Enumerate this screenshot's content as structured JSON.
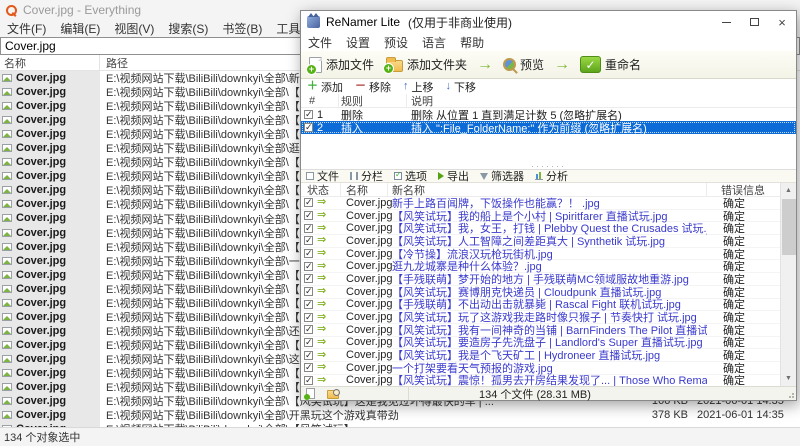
{
  "colors": {
    "selection": "#0c6bd7",
    "new_name_text": "#3a3acd",
    "accent_green": "#7cb82f",
    "everything_logo_orange": "#e25a1b"
  },
  "everything": {
    "window_title": "Cover.jpg - Everything",
    "menu": [
      "文件(F)",
      "编辑(E)",
      "视图(V)",
      "搜索(S)",
      "书签(B)",
      "工具(T)",
      "帮助(H)"
    ],
    "search_value": "Cover.jpg",
    "columns": {
      "name": "名称",
      "path": "路径"
    },
    "status": "134 个对象选中",
    "rows": [
      {
        "name": "Cover.jpg",
        "path": "E:\\视频网站下载\\BiliBili\\downkyi\\全部\\新手上路百闻牌，下饭操作也能赢？！",
        "size": "",
        "date": ""
      },
      {
        "name": "Cover.jpg",
        "path": "E:\\视频网站下载\\BiliBili\\downkyi\\全部\\【风笑试玩】我的船上是个小村 | Spiritfarer 直播试玩",
        "size": "",
        "date": ""
      },
      {
        "name": "Cover.jpg",
        "path": "E:\\视频网站下载\\BiliBili\\downkyi\\全部\\【风笑试玩】我，女王，打钱 | Plebby Quest the Crusades 试玩",
        "size": "",
        "date": ""
      },
      {
        "name": "Cover.jpg",
        "path": "E:\\视频网站下载\\BiliBili\\downkyi\\全部\\【风笑试玩】人工智障之间差距真大 | Synthetik 试玩",
        "size": "",
        "date": ""
      },
      {
        "name": "Cover.jpg",
        "path": "E:\\视频网站下载\\BiliBili\\downkyi\\全部\\【冷节操】流浪汉玩枪玩街机",
        "size": "",
        "date": ""
      },
      {
        "name": "Cover.jpg",
        "path": "E:\\视频网站下载\\BiliBili\\downkyi\\全部\\逛九龙城寨是种什么体验？",
        "size": "",
        "date": ""
      },
      {
        "name": "Cover.jpg",
        "path": "E:\\视频网站下载\\BiliBili\\downkyi\\全部\\【手残联萌】梦开始的地方 | 手残联萌MC领域服故地重游",
        "size": "",
        "date": ""
      },
      {
        "name": "Cover.jpg",
        "path": "E:\\视频网站下载\\BiliBili\\downkyi\\全部\\【风笑试玩】赛博朋克快递员 | Cloudpunk 直播试玩",
        "size": "",
        "date": ""
      },
      {
        "name": "Cover.jpg",
        "path": "E:\\视频网站下载\\BiliBili\\downkyi\\全部\\【手残联萌】不出动出击就暴毙 | Rascal Fight 联机试玩",
        "size": "",
        "date": ""
      },
      {
        "name": "Cover.jpg",
        "path": "E:\\视频网站下载\\BiliBili\\downkyi\\全部\\【风笑试玩】玩了这游戏我走路时像只猴子 | 节奏快打 试玩",
        "size": "",
        "date": ""
      },
      {
        "name": "Cover.jpg",
        "path": "E:\\视频网站下载\\BiliBili\\downkyi\\全部\\【风笑试玩】我有一间神奇的当铺 | BarnFinders The Pilot 直播试玩",
        "size": "",
        "date": ""
      },
      {
        "name": "Cover.jpg",
        "path": "E:\\视频网站下载\\BiliBili\\downkyi\\全部\\【风笑试玩】要造房子先洗盘子 | Landlord's Super 直播试玩",
        "size": "",
        "date": ""
      },
      {
        "name": "Cover.jpg",
        "path": "E:\\视频网站下载\\BiliBili\\downkyi\\全部\\【风笑试玩】我是个飞天矿工 | Hydroneer 直播试玩",
        "size": "",
        "date": ""
      },
      {
        "name": "Cover.jpg",
        "path": "E:\\视频网站下载\\BiliBili\\downkyi\\全部\\一个打架要看天气预报的游戏",
        "size": "",
        "date": ""
      },
      {
        "name": "Cover.jpg",
        "path": "E:\\视频网站下载\\BiliBili\\downkyi\\全部\\【风笑试玩】震惊！孤男去开房结果发现了... | Those Who Remain 试玩",
        "size": "",
        "date": ""
      },
      {
        "name": "Cover.jpg",
        "path": "E:\\视频网站下载\\BiliBili\\downkyi\\全部\\【风笑试玩】硬核剑",
        "size": "",
        "date": ""
      },
      {
        "name": "Cover.jpg",
        "path": "E:\\视频网站下载\\BiliBili\\downkyi\\全部\\【风笑试玩】神经兮",
        "size": "",
        "date": ""
      },
      {
        "name": "Cover.jpg",
        "path": "E:\\视频网站下载\\BiliBili\\downkyi\\全部\\【风笑试玩】我是个",
        "size": "",
        "date": ""
      },
      {
        "name": "Cover.jpg",
        "path": "E:\\视频网站下载\\BiliBili\\downkyi\\全部\\还是自虐游戏容易有",
        "size": "",
        "date": ""
      },
      {
        "name": "Cover.jpg",
        "path": "E:\\视频网站下载\\BiliBili\\downkyi\\全部\\【风笑试玩】山顶！",
        "size": "",
        "date": ""
      },
      {
        "name": "Cover.jpg",
        "path": "E:\\视频网站下载\\BiliBili\\downkyi\\全部\\这游戏针对我！！",
        "size": "",
        "date": ""
      },
      {
        "name": "Cover.jpg",
        "path": "E:\\视频网站下载\\BiliBili\\downkyi\\全部\\【风笑试玩】史上最",
        "size": "",
        "date": ""
      },
      {
        "name": "Cover.jpg",
        "path": "E:\\视频网站下载\\BiliBili\\downkyi\\全部\\【风笑试玩】天选之",
        "size": "",
        "date": ""
      },
      {
        "name": "Cover.jpg",
        "path": "E:\\视频网站下载\\BiliBili\\downkyi\\全部\\【风笑试玩】这是我见过坏得最快的车 | ...",
        "size": "166 KB",
        "date": "2021-06-01 14:35"
      },
      {
        "name": "Cover.jpg",
        "path": "E:\\视频网站下载\\BiliBili\\downkyi\\全部\\开黑玩这个游戏真带劲",
        "size": "378 KB",
        "date": "2021-06-01 14:35"
      },
      {
        "name": "Cover.jpg",
        "path": "E:\\视频网站下载\\BiliBili\\downkyi\\全部\\【风笑试玩】",
        "size": "",
        "date": ""
      }
    ]
  },
  "renamer": {
    "window_title": "ReNamer Lite",
    "license_note": "(仅用于非商业使用)",
    "menu": [
      "文件",
      "设置",
      "预设",
      "语言",
      "帮助"
    ],
    "toolbar": {
      "add_files": "添加文件",
      "add_folders": "添加文件夹",
      "preview": "预览",
      "rename": "重命名"
    },
    "rules_toolbar": {
      "add": "添加",
      "remove": "移除",
      "move_up": "上移",
      "move_down": "下移"
    },
    "rules_columns": {
      "num": "#",
      "rule": "规则",
      "description": "说明"
    },
    "rules": [
      {
        "num": "1",
        "rule": "删除",
        "description": "删除 从位置 1 直到满足计数 5 (忽略扩展名)",
        "checked": true,
        "selected": false
      },
      {
        "num": "2",
        "rule": "插入",
        "description": "插入 \":File_FolderName:\" 作为前缀 (忽略扩展名)",
        "checked": true,
        "selected": true
      }
    ],
    "files_toolbar": [
      "文件",
      "分栏",
      "选项",
      "导出",
      "筛选器",
      "分析"
    ],
    "files_columns": {
      "status": "状态",
      "name": "名称",
      "new_name": "新名称",
      "error": "错误信息"
    },
    "files": [
      {
        "name": "Cover.jpg",
        "new_name": "新手上路百闻牌，下饭操作也能赢？！ .jpg",
        "error": "确定"
      },
      {
        "name": "Cover.jpg",
        "new_name": "【风笑试玩】我的船上是个小村 | Spiritfarer 直播试玩.jpg",
        "error": "确定"
      },
      {
        "name": "Cover.jpg",
        "new_name": "【风笑试玩】我，女王，打钱 | Plebby Quest the Crusades 试玩.jpg",
        "error": "确定"
      },
      {
        "name": "Cover.jpg",
        "new_name": "【风笑试玩】人工智障之间差距真大 | Synthetik 试玩.jpg",
        "error": "确定"
      },
      {
        "name": "Cover.jpg",
        "new_name": "【冷节操】流浪汉玩枪玩街机.jpg",
        "error": "确定"
      },
      {
        "name": "Cover.jpg",
        "new_name": "逛九龙城寨是种什么体验？.jpg",
        "error": "确定"
      },
      {
        "name": "Cover.jpg",
        "new_name": "【手残联萌】梦开始的地方 | 手残联萌MC领域服故地重游.jpg",
        "error": "确定"
      },
      {
        "name": "Cover.jpg",
        "new_name": "【风笑试玩】赛博朋克快递员 | Cloudpunk 直播试玩.jpg",
        "error": "确定"
      },
      {
        "name": "Cover.jpg",
        "new_name": "【手残联萌】不出动出击就暴毙 | Rascal Fight 联机试玩.jpg",
        "error": "确定"
      },
      {
        "name": "Cover.jpg",
        "new_name": "【风笑试玩】玩了这游戏我走路时像只猴子 | 节奏快打 试玩.jpg",
        "error": "确定"
      },
      {
        "name": "Cover.jpg",
        "new_name": "【风笑试玩】我有一间神奇的当铺 | BarnFinders The Pilot 直播试玩.jpg",
        "error": "确定"
      },
      {
        "name": "Cover.jpg",
        "new_name": "【风笑试玩】要造房子先洗盘子 | Landlord's Super 直播试玩.jpg",
        "error": "确定"
      },
      {
        "name": "Cover.jpg",
        "new_name": "【风笑试玩】我是个飞天矿工 | Hydroneer 直播试玩.jpg",
        "error": "确定"
      },
      {
        "name": "Cover.jpg",
        "new_name": "一个打架要看天气预报的游戏.jpg",
        "error": "确定"
      },
      {
        "name": "Cover.jpg",
        "new_name": "【风笑试玩】震惊！孤男去开房结果发现了... | Those Who Remain 试玩.jpg",
        "error": "确定"
      }
    ],
    "status_bar": "134 个文件 (28.31 MB)"
  }
}
